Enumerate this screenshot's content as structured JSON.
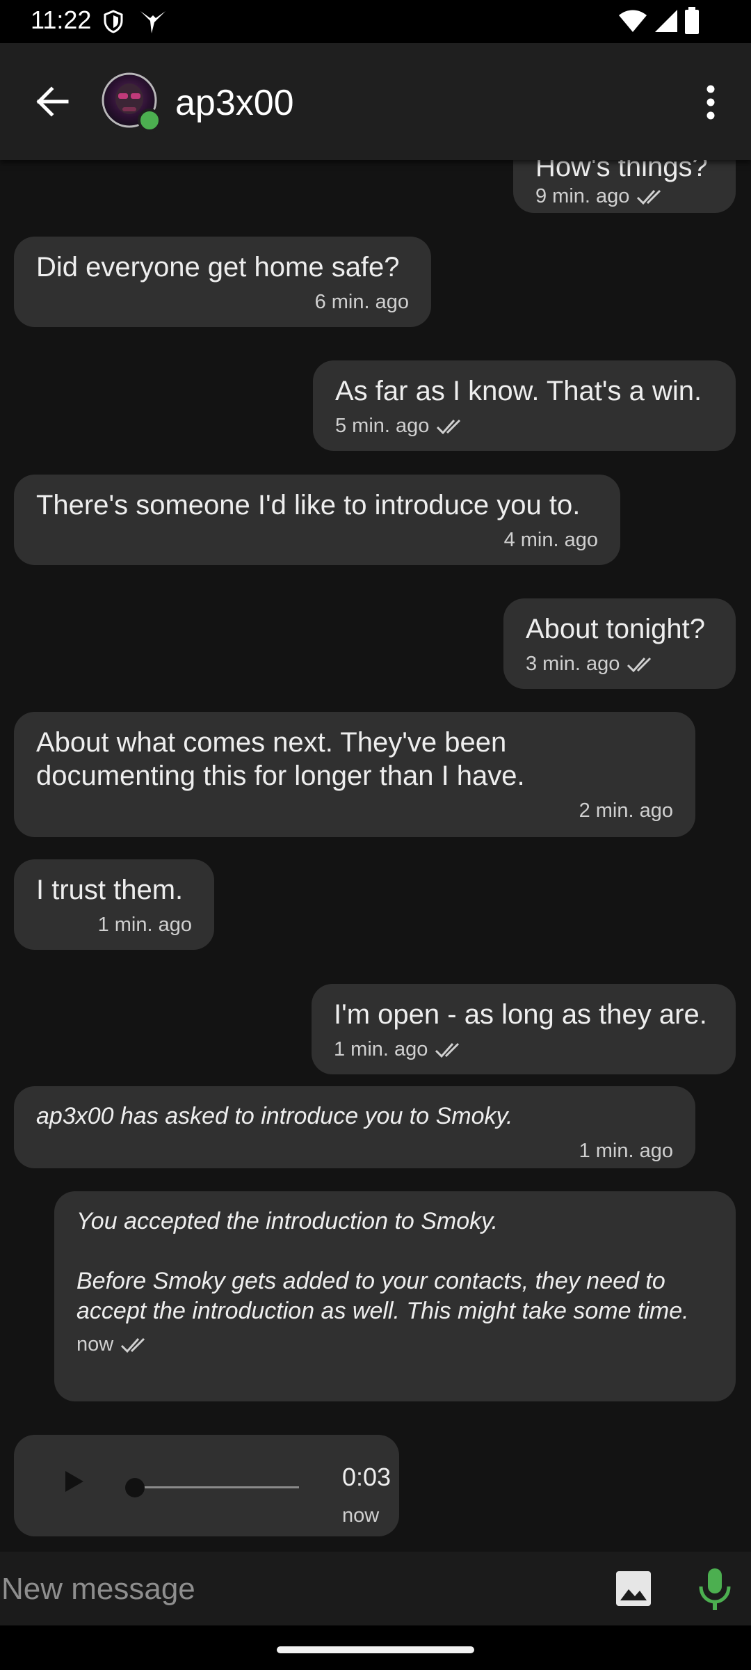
{
  "status_bar": {
    "time": "11:22"
  },
  "header": {
    "contact_name": "ap3x00",
    "online": true
  },
  "messages": [
    {
      "direction": "out",
      "text": "How's things?",
      "time": "9 min. ago",
      "delivered": true
    },
    {
      "direction": "in",
      "text": "Did everyone get home safe?",
      "time": "6 min. ago"
    },
    {
      "direction": "out",
      "text": "As far as I know. That's a win.",
      "time": "5 min. ago",
      "delivered": true
    },
    {
      "direction": "in",
      "text": "There's someone I'd like to introduce you to.",
      "time": "4 min. ago"
    },
    {
      "direction": "out",
      "text": "About tonight?",
      "time": "3 min. ago",
      "delivered": true
    },
    {
      "direction": "in",
      "text": "About what comes next. They've been documenting this for longer than I have.",
      "time": "2 min. ago"
    },
    {
      "direction": "in",
      "text": "I trust them.",
      "time": "1 min. ago"
    },
    {
      "direction": "out",
      "text": "I'm open - as long as they are.",
      "time": "1 min. ago",
      "delivered": true
    },
    {
      "direction": "in",
      "type": "notice",
      "text": "ap3x00 has asked to introduce you to Smoky.",
      "time": "1 min. ago"
    },
    {
      "direction": "out",
      "type": "notice",
      "text": "You accepted the introduction to Smoky.\n\nBefore Smoky gets added to your contacts, they need to accept the introduction as well. This might take some time.",
      "time": "now",
      "delivered": true
    }
  ],
  "audio_message": {
    "duration": "0:03",
    "time": "now",
    "progress": 0
  },
  "composer": {
    "placeholder": "New message"
  },
  "colors": {
    "background": "#131313",
    "bubble": "#303030",
    "app_bar": "#1f1f1f",
    "online_dot": "#4caf50",
    "mic": "#4caf50"
  },
  "icons": [
    "back-arrow-icon",
    "more-vert-icon",
    "image-icon",
    "mic-icon",
    "play-icon",
    "double-check-icon"
  ]
}
